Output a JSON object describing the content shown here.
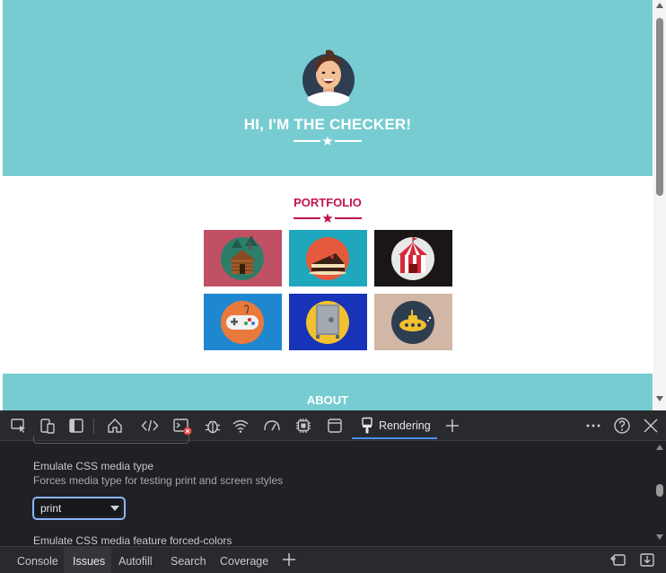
{
  "page": {
    "hero_title": "HI, I'M THE CHECKER!",
    "portfolio_title": "PORTFOLIO",
    "about_title": "ABOUT",
    "colors": {
      "hero_bg": "#77ccd1",
      "accent": "#c0144f",
      "white": "#ffffff"
    },
    "portfolio_items": [
      {
        "icon": "cabin-icon",
        "bg": "#c05064"
      },
      {
        "icon": "cake-icon",
        "bg": "#1fa8bd"
      },
      {
        "icon": "circus-tent-icon",
        "bg": "#1a1616"
      },
      {
        "icon": "game-controller-icon",
        "bg": "#1f87cf"
      },
      {
        "icon": "safe-icon",
        "bg": "#1733b8"
      },
      {
        "icon": "submarine-icon",
        "bg": "#d2b6a6"
      }
    ]
  },
  "devtools": {
    "toolbar_icons": [
      "inspect-icon",
      "device-toolbar-icon",
      "sidebar-toggle-icon",
      "welcome-home-icon",
      "elements-icon",
      "console-icon",
      "sources-bug-icon",
      "network-wifi-icon",
      "performance-icon",
      "memory-chip-icon",
      "application-icon",
      "rendering-brush-icon"
    ],
    "active_tab": "Rendering",
    "rendering": {
      "media_type_title": "Emulate CSS media type",
      "media_type_desc": "Forces media type for testing print and screen styles",
      "media_type_value": "print",
      "forced_colors_title": "Emulate CSS media feature forced-colors"
    },
    "drawer_tabs": [
      "Console",
      "Issues",
      "Autofill",
      "Search",
      "Coverage"
    ],
    "active_drawer_tab": "Issues",
    "error_badge": "x",
    "colors": {
      "panel_bg": "#202124",
      "toolbar_bg": "#292a2d",
      "tab_underline": "#4b8ef5",
      "focus_ring": "#8ab4f8",
      "error": "#e8453c"
    }
  }
}
